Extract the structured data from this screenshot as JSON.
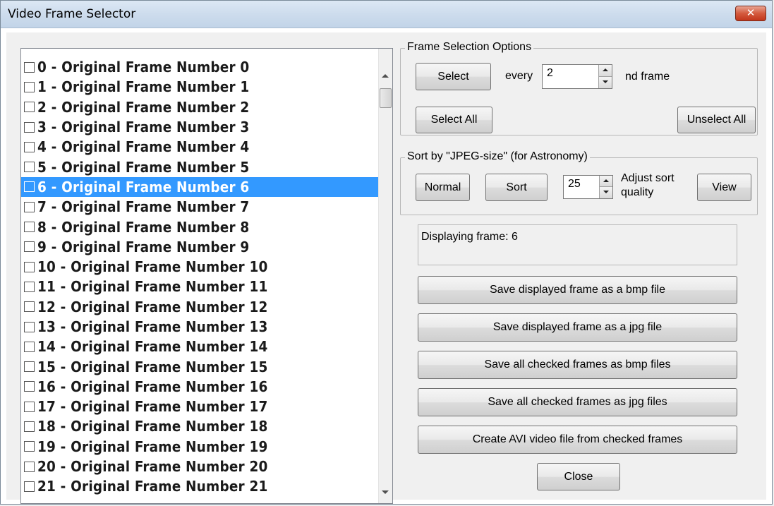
{
  "window": {
    "title": "Video Frame Selector",
    "close_glyph": "✕"
  },
  "frame_list": {
    "selected_index": 6,
    "items": [
      "0  -  Original Frame Number 0",
      "1  -  Original Frame Number 1",
      "2  -  Original Frame Number 2",
      "3  -  Original Frame Number 3",
      "4  -  Original Frame Number 4",
      "5  -  Original Frame Number 5",
      "6  -  Original Frame Number 6",
      "7  -  Original Frame Number 7",
      "8  -  Original Frame Number 8",
      "9  -  Original Frame Number 9",
      "10  -  Original Frame Number 10",
      "11  -  Original Frame Number 11",
      "12  -  Original Frame Number 12",
      "13  -  Original Frame Number 13",
      "14  -  Original Frame Number 14",
      "15  -  Original Frame Number 15",
      "16  -  Original Frame Number 16",
      "17  -  Original Frame Number 17",
      "18  -  Original Frame Number 18",
      "19  -  Original Frame Number 19",
      "20  -  Original Frame Number 20",
      "21  -  Original Frame Number 21"
    ]
  },
  "frame_selection": {
    "legend": "Frame Selection Options",
    "select_label": "Select",
    "every_label": "every",
    "every_value": "2",
    "suffix_label": "nd  frame",
    "select_all_label": "Select All",
    "unselect_all_label": "Unselect All"
  },
  "sort": {
    "legend": "Sort by \"JPEG-size\" (for Astronomy)",
    "normal_label": "Normal",
    "sort_label": "Sort",
    "quality_value": "25",
    "adjust_line1": "Adjust sort",
    "adjust_line2": "quality",
    "view_label": "View"
  },
  "status": {
    "text": "Displaying frame:  6"
  },
  "actions": {
    "save_bmp": "Save displayed frame as a bmp file",
    "save_jpg": "Save displayed frame as a jpg file",
    "save_all_bmp": "Save all checked frames as bmp files",
    "save_all_jpg": "Save all checked frames as jpg files",
    "create_avi": "Create AVI video file from checked frames",
    "close": "Close"
  }
}
